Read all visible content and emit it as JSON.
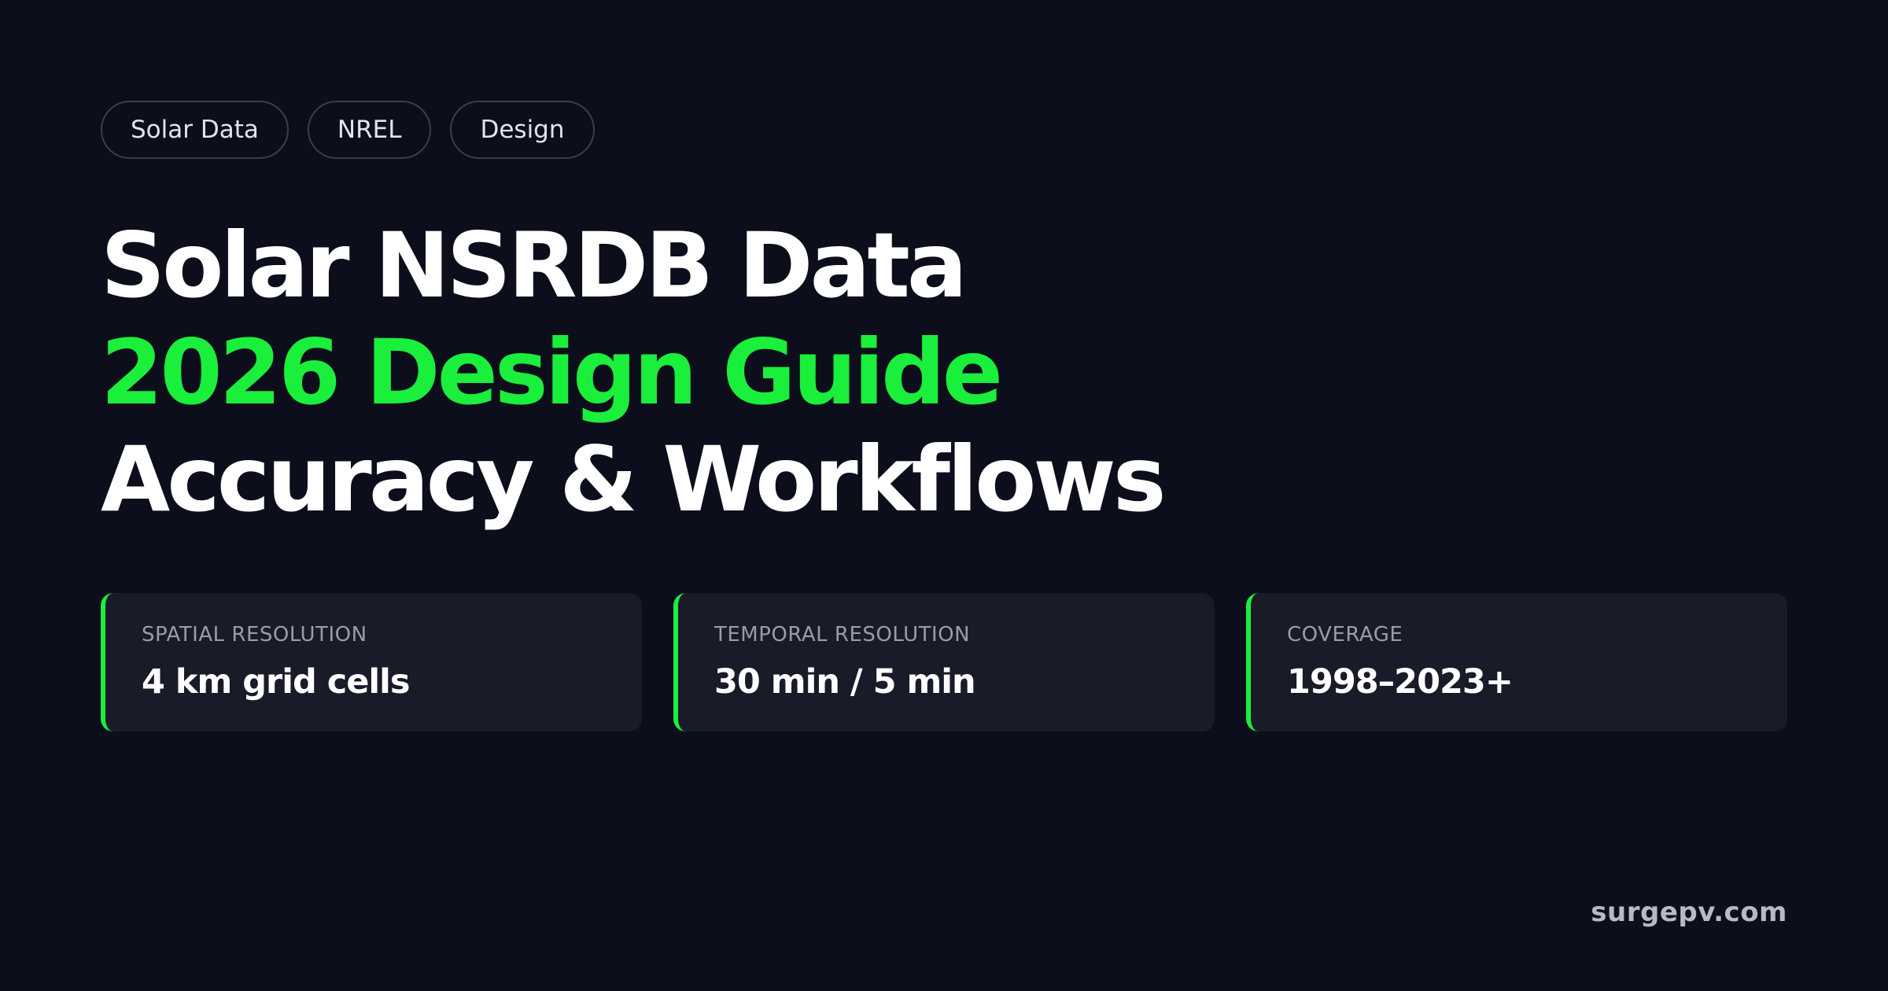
{
  "tags": [
    "Solar Data",
    "NREL",
    "Design"
  ],
  "title": {
    "line1": "Solar NSRDB Data",
    "line2": "2026 Design Guide",
    "line3": "Accuracy & Workflows"
  },
  "stats": [
    {
      "label": "SPATIAL RESOLUTION",
      "value": "4 km grid cells"
    },
    {
      "label": "TEMPORAL RESOLUTION",
      "value": "30 min / 5 min"
    },
    {
      "label": "COVERAGE",
      "value": "1998–2023+"
    }
  ],
  "footer": {
    "domain": "surgepv.com"
  },
  "colors": {
    "background": "#0d0e1c",
    "accent": "#1aef3c",
    "card": "#1a1b29"
  }
}
